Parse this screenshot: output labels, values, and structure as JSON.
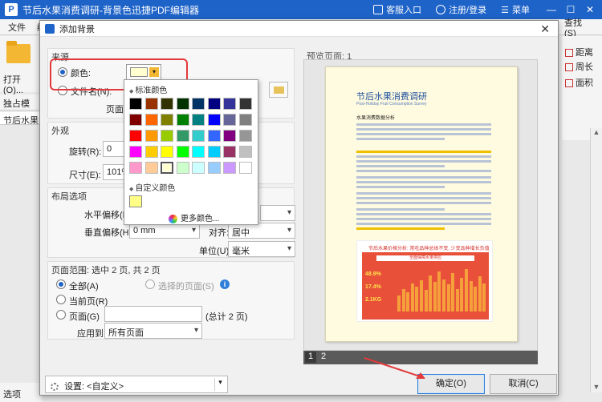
{
  "app": {
    "title": "节后水果消费调研-背景色迅捷PDF编辑器",
    "customer_entry": "客服入口",
    "register_login": "注册/登录",
    "menu": "菜单",
    "window_min": "—",
    "window_max": "☐",
    "window_close": "✕"
  },
  "menubar": {
    "items": [
      "文件",
      "编"
    ],
    "right_item": "查找(S)"
  },
  "toolbar": {
    "open_label": "打开(O)..."
  },
  "left_panel": {
    "tab_label": "独占模",
    "doc_tab": "节后水果消",
    "bottom_label": "选项"
  },
  "right_tools": {
    "items": [
      "距离",
      "周长",
      "面积"
    ]
  },
  "dialog": {
    "title": "添加背景",
    "close": "✕",
    "source": {
      "section_title": "来源",
      "color_label": "颜色:",
      "file_label": "文件名(N):",
      "page_label": "页面:",
      "selected_color": "#ffffd0"
    },
    "color_popup": {
      "standard_title": "标准颜色",
      "custom_title": "自定义颜色",
      "more_colors": "更多颜色...",
      "standard_colors": [
        "#000000",
        "#993300",
        "#333300",
        "#003300",
        "#003366",
        "#000080",
        "#333399",
        "#333333",
        "#800000",
        "#ff6600",
        "#808000",
        "#008000",
        "#008080",
        "#0000ff",
        "#666699",
        "#808080",
        "#ff0000",
        "#ff9900",
        "#99cc00",
        "#339966",
        "#33cccc",
        "#3366ff",
        "#800080",
        "#969696",
        "#ff00ff",
        "#ffcc00",
        "#ffff00",
        "#00ff00",
        "#00ffff",
        "#00ccff",
        "#993366",
        "#c0c0c0",
        "#ff99cc",
        "#ffcc99",
        "#ffffd0",
        "#ccffcc",
        "#ccffff",
        "#99ccff",
        "#cc99ff",
        "#ffffff"
      ],
      "selected_index": 34,
      "custom_colors": [
        "#ffff88"
      ]
    },
    "appearance": {
      "section_title": "外观",
      "rotation_label": "旋转(R):",
      "rotation_value": "0",
      "size_label": "尺寸(E):",
      "size_value": "101%"
    },
    "layout": {
      "section_title": "布局选项",
      "h_offset_label": "水平偏移(H):",
      "v_offset_label": "垂直偏移(H):",
      "v_offset_value": "0 mm",
      "align_label": "对齐:",
      "align_value": "居中",
      "unit_label": "单位(U):",
      "unit_value": "毫米"
    },
    "page_range": {
      "section_title": "页面范围: 选中 2 页, 共 2 页",
      "all_label": "全部(A)",
      "selected_pages_label": "选择的页面(S)",
      "current_label": "当前页(R)",
      "pages_label": "页面(G)",
      "total_label": "(总计 2 页)",
      "apply_to_label": "应用到:",
      "apply_to_value": "所有页面"
    },
    "preview": {
      "label": "预览页面: 1",
      "pages": [
        "1",
        "2"
      ],
      "doc_title": "节后水果消费调研",
      "doc_subtitle": "Post-Holiday Fruit Consumption Survey",
      "doc_heading": "水果消费数据分析",
      "chart_title": "节后水果价格分析: 常吃品种总体不变, 少变品种增长负值",
      "chart_banner": "全面保障水果供应",
      "stats": [
        "48.9%",
        "17.4%",
        "2.1KG"
      ],
      "bar_heights": [
        0.35,
        0.5,
        0.42,
        0.62,
        0.55,
        0.7,
        0.48,
        0.8,
        0.66,
        0.9,
        0.72,
        0.6,
        0.85,
        0.5,
        0.75,
        0.95,
        0.68,
        0.55,
        0.78,
        0.62
      ]
    },
    "settings": {
      "label": "设置: <自定义>"
    },
    "buttons": {
      "ok": "确定(O)",
      "cancel": "取消(C)"
    }
  },
  "colors": {
    "accent": "#1e63c8",
    "highlight_box": "#e23a3a",
    "page_background": "#fffbe0"
  }
}
